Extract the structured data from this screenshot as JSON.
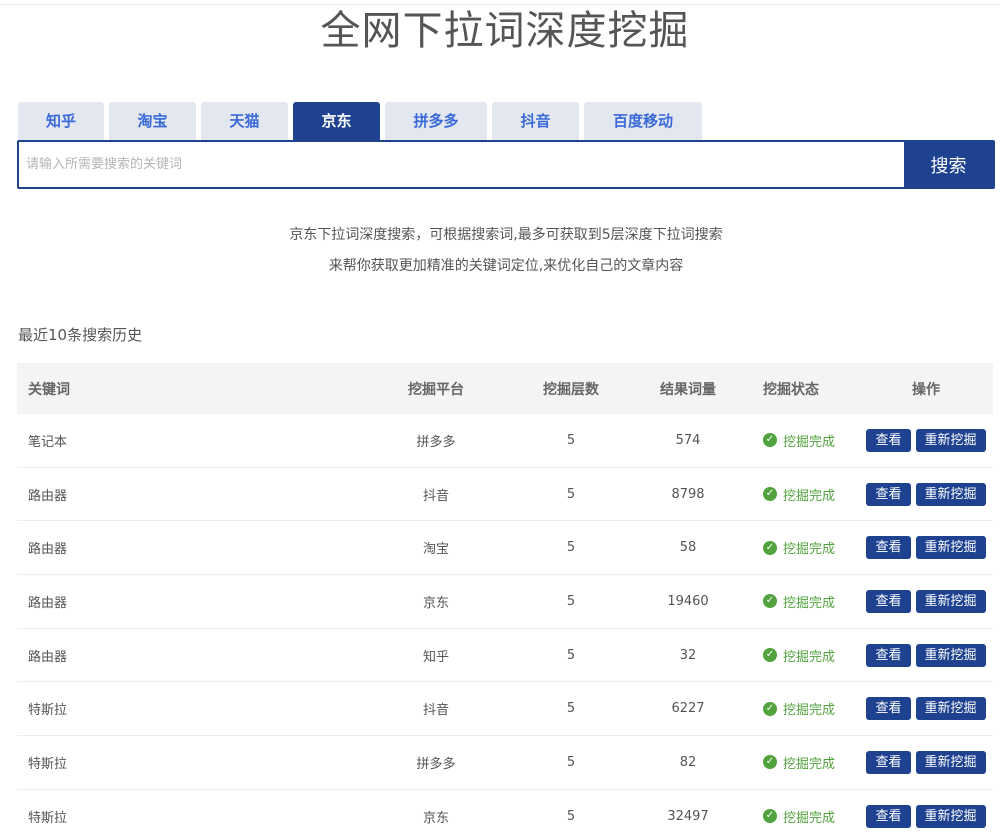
{
  "title": "全网下拉词深度挖掘",
  "tabs": [
    {
      "label": "知乎",
      "active": false
    },
    {
      "label": "淘宝",
      "active": false
    },
    {
      "label": "天猫",
      "active": false
    },
    {
      "label": "京东",
      "active": true
    },
    {
      "label": "拼多多",
      "active": false
    },
    {
      "label": "抖音",
      "active": false
    },
    {
      "label": "百度移动",
      "active": false
    }
  ],
  "search": {
    "placeholder": "请输入所需要搜索的关键词",
    "value": "",
    "button_label": "搜索"
  },
  "intro": {
    "line1": "京东下拉词深度搜索，可根据搜索词,最多可获取到5层深度下拉词搜索",
    "line2": "来帮你获取更加精准的关键词定位,来优化自己的文章内容"
  },
  "history": {
    "title": "最近10条搜索历史",
    "columns": {
      "keyword": "关键词",
      "platform": "挖掘平台",
      "depth": "挖掘层数",
      "count": "结果词量",
      "status": "挖掘状态",
      "ops": "操作"
    },
    "view_label": "查看",
    "remine_label": "重新挖掘",
    "rows": [
      {
        "keyword": "笔记本",
        "platform": "拼多多",
        "depth": "5",
        "count": "574",
        "status": "挖掘完成"
      },
      {
        "keyword": "路由器",
        "platform": "抖音",
        "depth": "5",
        "count": "8798",
        "status": "挖掘完成"
      },
      {
        "keyword": "路由器",
        "platform": "淘宝",
        "depth": "5",
        "count": "58",
        "status": "挖掘完成"
      },
      {
        "keyword": "路由器",
        "platform": "京东",
        "depth": "5",
        "count": "19460",
        "status": "挖掘完成"
      },
      {
        "keyword": "路由器",
        "platform": "知乎",
        "depth": "5",
        "count": "32",
        "status": "挖掘完成"
      },
      {
        "keyword": "特斯拉",
        "platform": "抖音",
        "depth": "5",
        "count": "6227",
        "status": "挖掘完成"
      },
      {
        "keyword": "特斯拉",
        "platform": "拼多多",
        "depth": "5",
        "count": "82",
        "status": "挖掘完成"
      },
      {
        "keyword": "特斯拉",
        "platform": "京东",
        "depth": "5",
        "count": "32497",
        "status": "挖掘完成"
      }
    ]
  },
  "colors": {
    "primary": "#1e4290",
    "tab_text": "#3a6ad8",
    "tab_bg": "#e3e7ef",
    "success": "#52a33e"
  },
  "icons": {
    "status": "check-circle-icon"
  }
}
